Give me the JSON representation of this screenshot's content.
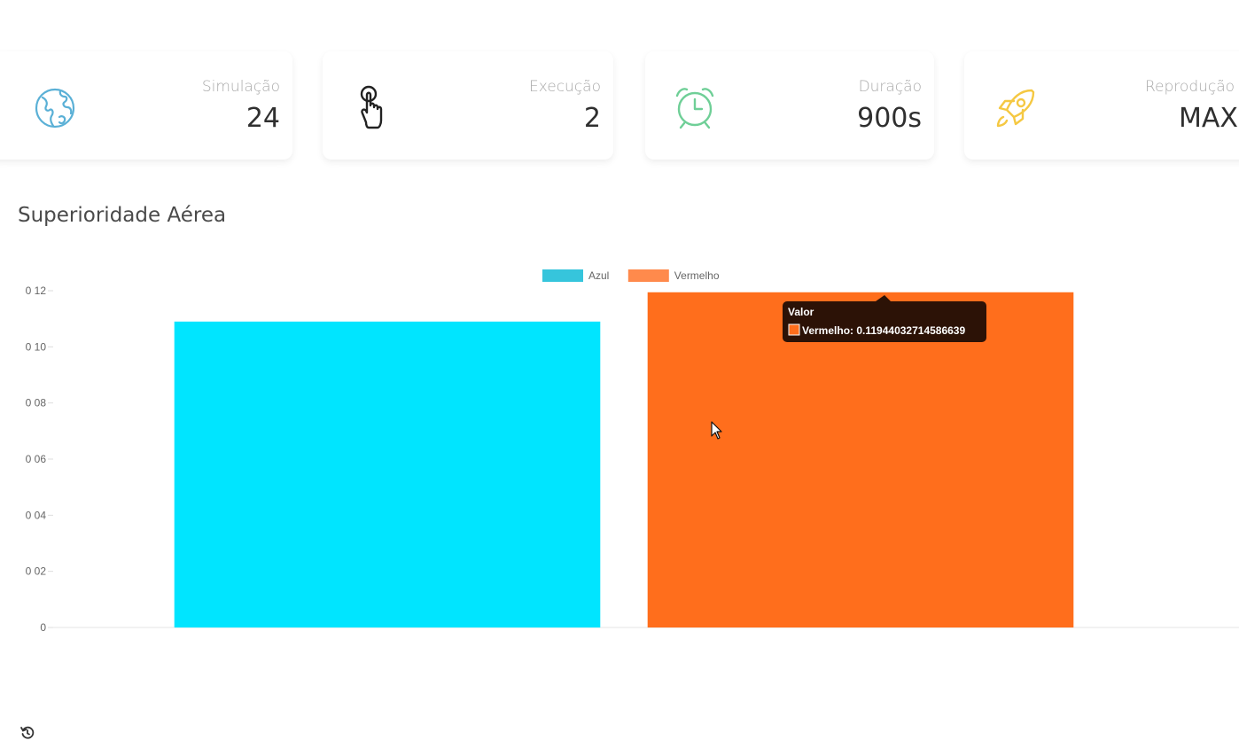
{
  "stats": [
    {
      "label": "Simulação",
      "value": "24",
      "icon": "globe-icon",
      "icon_color": "#5ab0d6"
    },
    {
      "label": "Execução",
      "value": "2",
      "icon": "pointer-hand-icon",
      "icon_color": "#222222"
    },
    {
      "label": "Duração",
      "value": "900s",
      "icon": "alarm-clock-icon",
      "icon_color": "#6fcf97"
    },
    {
      "label": "Reprodução",
      "value": "MAX",
      "icon": "rocket-icon",
      "icon_color": "#f5c842"
    }
  ],
  "section_title": "Superioridade Aérea",
  "chart_data": {
    "type": "bar",
    "title": "",
    "series": [
      {
        "name": "Azul",
        "value": 0.109,
        "color": "#00e5ff",
        "legend_color": "#36c5dc"
      },
      {
        "name": "Vermelho",
        "value": 0.11944032714586639,
        "color": "#ff6e1c",
        "legend_color": "#ff8a4c"
      }
    ],
    "ylim": [
      0,
      0.12
    ],
    "yticks": [
      "0",
      "0 02",
      "0 04",
      "0 06",
      "0 08",
      "0 10",
      "0 12"
    ],
    "legend_position": "top-center",
    "grid": false
  },
  "tooltip": {
    "title": "Valor",
    "text": "Vermelho: 0.11944032714586639",
    "swatch_color": "#ff6e1c"
  },
  "footer": {
    "refresh_icon": "refresh-icon"
  }
}
